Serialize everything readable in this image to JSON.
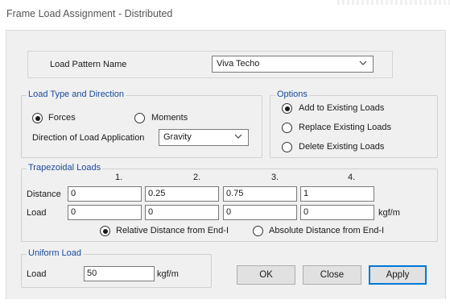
{
  "window": {
    "title": "Frame Load Assignment - Distributed"
  },
  "load_pattern": {
    "label": "Load Pattern Name",
    "value": "Viva Techo"
  },
  "load_type": {
    "legend": "Load Type and Direction",
    "forces_label": "Forces",
    "moments_label": "Moments",
    "selected": "Forces",
    "direction_label": "Direction of Load Application",
    "direction_value": "Gravity"
  },
  "options": {
    "legend": "Options",
    "items": [
      "Add to Existing Loads",
      "Replace Existing Loads",
      "Delete Existing Loads"
    ],
    "selected": "Add to Existing Loads"
  },
  "trapezoidal": {
    "legend": "Trapezoidal Loads",
    "column_headers": [
      "1.",
      "2.",
      "3.",
      "4."
    ],
    "distance_label": "Distance",
    "distance_values": [
      "0",
      "0.25",
      "0.75",
      "1"
    ],
    "load_label": "Load",
    "load_values": [
      "0",
      "0",
      "0",
      "0"
    ],
    "unit": "kgf/m",
    "relative_label": "Relative Distance from End-I",
    "absolute_label": "Absolute Distance from End-I",
    "distance_mode": "Relative Distance from End-I"
  },
  "uniform": {
    "legend": "Uniform Load",
    "load_label": "Load",
    "load_value": "50",
    "unit": "kgf/m"
  },
  "buttons": {
    "ok": "OK",
    "close": "Close",
    "apply": "Apply"
  },
  "colors": {
    "legend_blue": "#1a4a9a",
    "dialog_bg": "#f0f0f0",
    "default_button_border": "#0078d7"
  },
  "icons": {
    "dropdown": "chevron-down-icon",
    "radio_selected": "radio-selected-icon",
    "radio_unselected": "radio-unselected-icon"
  }
}
